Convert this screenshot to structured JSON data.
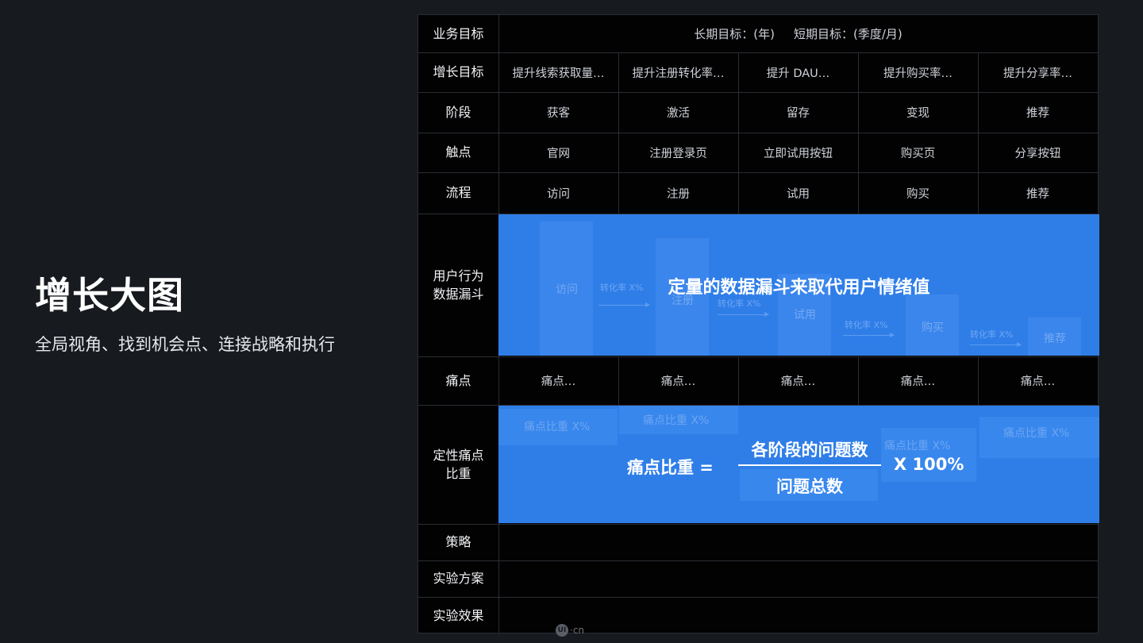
{
  "headline": "增长大图",
  "subline": "全局视角、找到机会点、连接战略和执行",
  "table": {
    "row_labels": {
      "business_goal": "业务目标",
      "growth_goal": "增长目标",
      "stage": "阶段",
      "touchpoint": "触点",
      "flow": "流程",
      "funnel": "用户行为\n数据漏斗",
      "pain": "痛点",
      "pain_weight": "定性痛点\n比重",
      "strategy": "策略",
      "experiment_plan": "实验方案",
      "experiment_result": "实验效果"
    },
    "business_goal": {
      "long_term": "长期目标：(年)",
      "short_term": "短期目标：(季度/月)"
    },
    "growth_goals": [
      "提升线索获取量…",
      "提升注册转化率…",
      "提升 DAU…",
      "提升购买率…",
      "提升分享率…"
    ],
    "stages": [
      "获客",
      "激活",
      "留存",
      "变现",
      "推荐"
    ],
    "touchpoints": [
      "官网",
      "注册登录页",
      "立即试用按钮",
      "购买页",
      "分享按钮"
    ],
    "flows": [
      "访问",
      "注册",
      "试用",
      "购买",
      "推荐"
    ],
    "pains": [
      "痛点…",
      "痛点…",
      "痛点…",
      "痛点…",
      "痛点…"
    ]
  },
  "funnel": {
    "title": "定量的数据漏斗来取代用户情绪值",
    "bars": [
      "访问",
      "注册",
      "试用",
      "购买",
      "推荐"
    ],
    "bar_levels": [
      0.95,
      0.83,
      0.58,
      0.43,
      0.27
    ],
    "rate_label": "转化率 X%"
  },
  "pain_weight": {
    "block_label": "痛点比重 X%",
    "lhs": "痛点比重 =",
    "numerator": "各阶段的问题数",
    "denominator": "问题总数",
    "rhs": "X 100%"
  },
  "watermark": {
    "icon_text": "UI",
    "text": "·cn"
  },
  "colors": {
    "background": "#171a1f",
    "board": "#020203",
    "panel_blue": "#2f7ee8"
  }
}
